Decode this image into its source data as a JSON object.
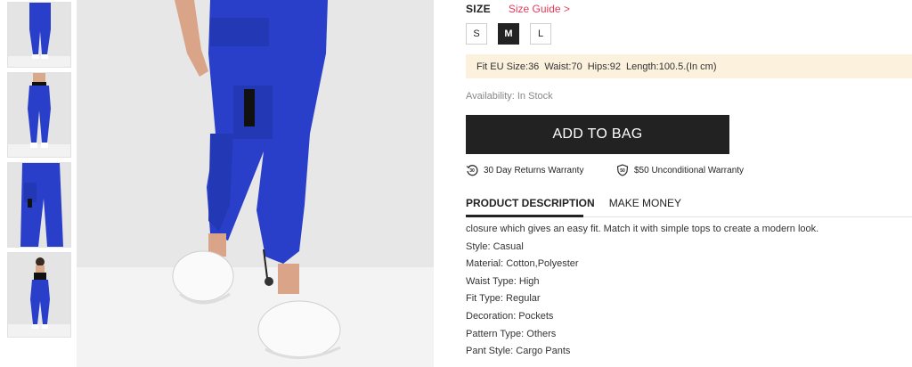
{
  "size": {
    "label": "SIZE",
    "guide": "Size Guide >",
    "options": [
      "S",
      "M",
      "L"
    ],
    "selected": "M"
  },
  "fit": {
    "eu_size": "Fit EU Size:36",
    "waist": "Waist:70",
    "hips": "Hips:92",
    "length": "Length:100.5.(In cm)"
  },
  "availability": "Availability: In Stock",
  "add_to_bag": "ADD TO BAG",
  "warranties": {
    "returns": "30 Day Returns Warranty",
    "returns_badge": "30",
    "unconditional": "$50 Unconditional Warranty",
    "unconditional_badge": "50"
  },
  "tabs": {
    "description": "PRODUCT DESCRIPTION",
    "make_money": "MAKE MONEY"
  },
  "description": {
    "intro": "closure which gives an easy fit. Match it with simple tops to create a modern look.",
    "attributes": [
      "Style: Casual",
      "Material: Cotton,Polyester",
      "Waist Type: High",
      "Fit Type: Regular",
      "Decoration: Pockets",
      "Pattern Type: Others",
      "Pant Style: Cargo Pants"
    ]
  },
  "colors": {
    "accent": "#e23b5a",
    "button": "#222222",
    "fit_bg": "#fcf1dd",
    "product_blue": "#2a3fc9"
  },
  "icons": {
    "returns": "returns-30-icon",
    "shield": "shield-50-icon"
  }
}
